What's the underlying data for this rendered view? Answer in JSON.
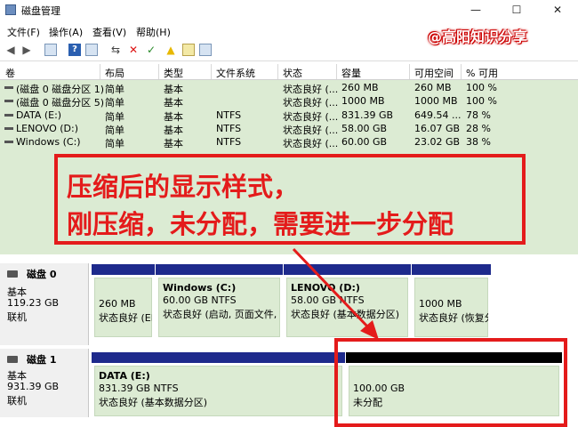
{
  "window": {
    "title": "磁盘管理",
    "min": "—",
    "max": "☐",
    "close": "✕"
  },
  "menu": [
    "文件(F)",
    "操作(A)",
    "查看(V)",
    "帮助(H)"
  ],
  "watermark": "@高阳知识分享",
  "columns": [
    "卷",
    "布局",
    "类型",
    "文件系统",
    "状态",
    "容量",
    "可用空间",
    "% 可用"
  ],
  "volumes": [
    {
      "name": "(磁盘 0 磁盘分区 1)",
      "layout": "简单",
      "type": "基本",
      "fs": "",
      "status": "状态良好 (...",
      "capacity": "260 MB",
      "free": "260 MB",
      "pct": "100 %"
    },
    {
      "name": "(磁盘 0 磁盘分区 5)",
      "layout": "简单",
      "type": "基本",
      "fs": "",
      "status": "状态良好 (...",
      "capacity": "1000 MB",
      "free": "1000 MB",
      "pct": "100 %"
    },
    {
      "name": "DATA (E:)",
      "layout": "简单",
      "type": "基本",
      "fs": "NTFS",
      "status": "状态良好 (...",
      "capacity": "831.39 GB",
      "free": "649.54 ...",
      "pct": "78 %"
    },
    {
      "name": "LENOVO (D:)",
      "layout": "简单",
      "type": "基本",
      "fs": "NTFS",
      "status": "状态良好 (...",
      "capacity": "58.00 GB",
      "free": "16.07 GB",
      "pct": "28 %"
    },
    {
      "name": "Windows (C:)",
      "layout": "简单",
      "type": "基本",
      "fs": "NTFS",
      "status": "状态良好 (...",
      "capacity": "60.00 GB",
      "free": "23.02 GB",
      "pct": "38 %"
    }
  ],
  "annotation": {
    "line1": "压缩后的显示样式，",
    "line2": "刚压缩，未分配，需要进一步分配"
  },
  "disks": [
    {
      "name": "磁盘 0",
      "type": "基本",
      "size": "119.23 GB",
      "state": "联机",
      "partitions": [
        {
          "name": "",
          "size": "260 MB",
          "status": "状态良好 (EF"
        },
        {
          "name": "Windows  (C:)",
          "size": "60.00 GB NTFS",
          "status": "状态良好 (启动, 页面文件, 故"
        },
        {
          "name": "LENOVO  (D:)",
          "size": "58.00 GB NTFS",
          "status": "状态良好 (基本数据分区)"
        },
        {
          "name": "",
          "size": "1000 MB",
          "status": "状态良好 (恢复分"
        }
      ]
    },
    {
      "name": "磁盘 1",
      "type": "基本",
      "size": "931.39 GB",
      "state": "联机",
      "partitions": [
        {
          "name": "DATA  (E:)",
          "size": "831.39 GB NTFS",
          "status": "状态良好 (基本数据分区)"
        },
        {
          "name": "",
          "size": "100.00 GB",
          "status": "未分配"
        }
      ]
    }
  ],
  "colors": {
    "primary_bar": "#1e2a8c",
    "unallocated_bar": "#000000",
    "annotation": "#e41b1b",
    "row_bg": "#dcebd3"
  }
}
